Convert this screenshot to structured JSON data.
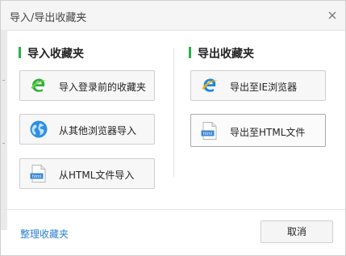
{
  "dialog": {
    "title": "导入/导出收藏夹"
  },
  "import_section": {
    "heading": "导入收藏夹",
    "buttons": [
      {
        "label": "导入登录前的收藏夹",
        "icon": "browser-e-green-icon"
      },
      {
        "label": "从其他浏览器导入",
        "icon": "globe-icon"
      },
      {
        "label": "从HTML文件导入",
        "icon": "html-file-icon"
      }
    ]
  },
  "export_section": {
    "heading": "导出收藏夹",
    "buttons": [
      {
        "label": "导出至IE浏览器",
        "icon": "ie-icon"
      },
      {
        "label": "导出至HTML文件",
        "icon": "html-file-icon"
      }
    ]
  },
  "footer": {
    "manage_link": "整理收藏夹",
    "cancel_label": "取消"
  },
  "colors": {
    "accent_green": "#27b24a",
    "link_blue": "#2b7fd1"
  }
}
